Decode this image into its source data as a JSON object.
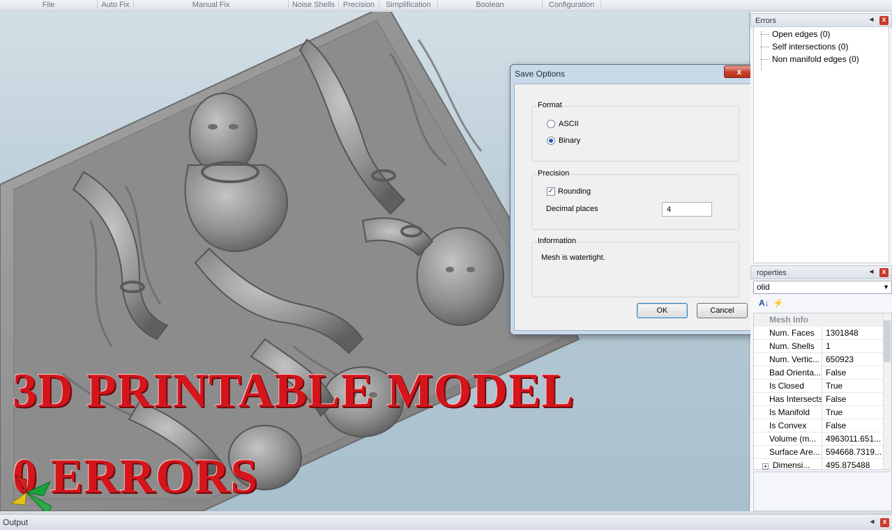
{
  "ribbon": {
    "groups": [
      "File",
      "Auto Fix",
      "Manual Fix",
      "Noise Shells",
      "Precision",
      "Simplification",
      "Boolean",
      "Configuration"
    ]
  },
  "overlay": {
    "line1": "3D PRINTABLE MODEL",
    "line2": "0 ERRORS"
  },
  "dialog": {
    "title": "Save Options",
    "close_glyph": "x",
    "format": {
      "label": "Format",
      "options": [
        {
          "label": "ASCII",
          "selected": false
        },
        {
          "label": "Binary",
          "selected": true
        }
      ]
    },
    "precision": {
      "label": "Precision",
      "rounding_label": "Rounding",
      "rounding_checked": true,
      "decimal_label": "Decimal places",
      "decimal_value": "4"
    },
    "information": {
      "label": "Information",
      "text": "Mesh is watertight."
    },
    "ok_label": "OK",
    "cancel_label": "Cancel"
  },
  "errors_panel": {
    "title": "Errors",
    "items": [
      "Open edges (0)",
      "Self intersections (0)",
      "Non manifold edges (0)"
    ]
  },
  "properties_panel": {
    "title": "roperties",
    "selected_object": "olid",
    "category": "Mesh Info",
    "rows": [
      {
        "name": "Num. Faces",
        "value": "1301848"
      },
      {
        "name": "Num. Shells",
        "value": "1"
      },
      {
        "name": "Num. Vertic...",
        "value": "650923"
      },
      {
        "name": "Bad Orienta...",
        "value": "False"
      },
      {
        "name": "Is Closed",
        "value": "True"
      },
      {
        "name": "Has Intersects",
        "value": "False"
      },
      {
        "name": "Is Manifold",
        "value": "True"
      },
      {
        "name": "Is Convex",
        "value": "False"
      },
      {
        "name": "Volume (m...",
        "value": "4963011.651..."
      },
      {
        "name": "Surface Are...",
        "value": "594668.7319..."
      },
      {
        "name": "Dimensi...",
        "value": "495.875488"
      }
    ]
  },
  "output_bar": {
    "title": "Output"
  }
}
